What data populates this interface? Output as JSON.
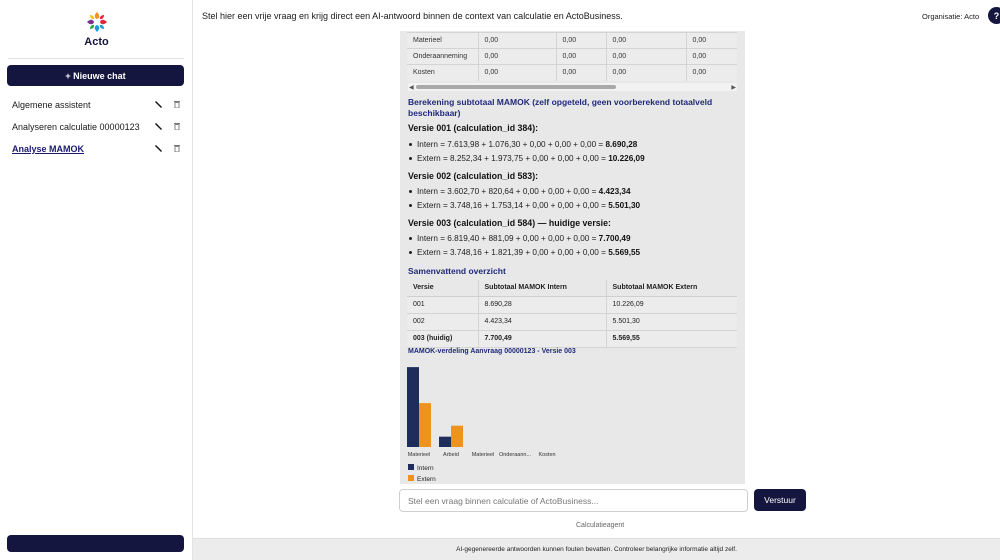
{
  "brand": {
    "name": "Acto"
  },
  "sidebar": {
    "new_chat_label": "+ Nieuwe chat",
    "items": [
      {
        "label": "Algemene assistent",
        "active": false
      },
      {
        "label": "Analyseren calculatie 00000123",
        "active": false
      },
      {
        "label": "Analyse MAMOK",
        "active": true
      }
    ]
  },
  "header": {
    "instruction": "Stel hier een vrije vraag en krijg direct een AI-antwoord binnen de context van calculatie en ActoBusiness.",
    "organisation": "Organisatie: Acto",
    "help_label": "?"
  },
  "message": {
    "top_table": {
      "rows": [
        [
          "Materieel",
          "0,00",
          "0,00",
          "0,00",
          "0,00"
        ],
        [
          "Onderaanneming",
          "0,00",
          "0,00",
          "0,00",
          "0,00"
        ],
        [
          "Kosten",
          "0,00",
          "0,00",
          "0,00",
          "0,00"
        ]
      ]
    },
    "calc_heading": "Berekening subtotaal MAMOK (zelf opgeteld, geen voorberekend totaalveld beschikbaar)",
    "versions": [
      {
        "heading": "Versie 001 (calculation_id 384):",
        "intern_expr": "Intern = 7.613,98 + 1.076,30 + 0,00 + 0,00 + 0,00 = ",
        "intern_total": "8.690,28",
        "extern_expr": "Extern = 8.252,34 + 1.973,75 + 0,00 + 0,00 + 0,00 = ",
        "extern_total": "10.226,09"
      },
      {
        "heading": "Versie 002 (calculation_id 583):",
        "intern_expr": "Intern = 3.602,70 + 820,64 + 0,00 + 0,00 + 0,00 = ",
        "intern_total": "4.423,34",
        "extern_expr": "Extern = 3.748,16 + 1.753,14 + 0,00 + 0,00 + 0,00 = ",
        "extern_total": "5.501,30"
      },
      {
        "heading": "Versie 003 (calculation_id 584) — huidige versie:",
        "intern_expr": "Intern = 6.819,40 + 881,09 + 0,00 + 0,00 + 0,00 = ",
        "intern_total": "7.700,49",
        "extern_expr": "Extern = 3.748,16 + 1.821,39 + 0,00 + 0,00 + 0,00 = ",
        "extern_total": "5.569,55"
      }
    ],
    "summary_heading": "Samenvattend overzicht",
    "summary_table": {
      "headers": [
        "Versie",
        "Subtotaal MAMOK Intern",
        "Subtotaal MAMOK Extern"
      ],
      "rows": [
        [
          "001",
          "8.690,28",
          "10.226,09"
        ],
        [
          "002",
          "4.423,34",
          "5.501,30"
        ],
        [
          "003 (huidig)",
          "7.700,49",
          "5.569,55"
        ]
      ]
    }
  },
  "chart_data": {
    "type": "bar",
    "title": "MAMOK-verdeling Aanvraag 00000123 - Versie 003",
    "categories": [
      "Materieel",
      "Arbeid",
      "Materieel",
      "Onderaann...",
      "Kosten"
    ],
    "series": [
      {
        "name": "Intern",
        "color": "#1f2d5c",
        "values": [
          6819.4,
          881.09,
          0,
          0,
          0
        ]
      },
      {
        "name": "Extern",
        "color": "#f0931e",
        "values": [
          3748.16,
          1821.39,
          0,
          0,
          0
        ]
      }
    ],
    "ylim": [
      0,
      7000
    ],
    "grid": false,
    "legend": "bottom-left"
  },
  "input": {
    "placeholder": "Stel een vraag binnen calculatie of ActoBusiness...",
    "send_label": "Verstuur",
    "agent_label": "Calculatieagent"
  },
  "footer": {
    "disclaimer": "AI-gegenereerde antwoorden kunnen fouten bevatten. Controleer belangrijke informatie altijd zelf."
  }
}
